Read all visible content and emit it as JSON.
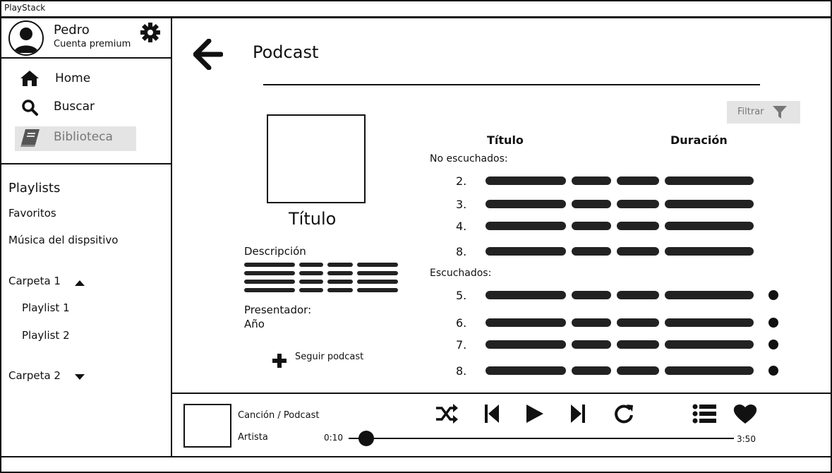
{
  "app": {
    "title": "PlayStack"
  },
  "user": {
    "name": "Pedro",
    "plan": "Cuenta premium"
  },
  "nav": {
    "home": "Home",
    "search": "Buscar",
    "library": "Biblioteca"
  },
  "sidebar": {
    "playlists_title": "Playlists",
    "items": [
      "Favoritos",
      "Música del dispsitivo"
    ],
    "folders": [
      {
        "label": "Carpeta 1",
        "expanded": true,
        "playlists": [
          "Playlist 1",
          "Playlist 2"
        ]
      },
      {
        "label": "Carpeta 2",
        "expanded": false,
        "playlists": []
      }
    ]
  },
  "page": {
    "title": "Podcast",
    "filter_label": "Filtrar"
  },
  "podcast": {
    "title": "Título",
    "description_label": "Descripción",
    "presenter_label": "Presentador:",
    "year_label": "Año",
    "follow_label": "Seguir podcast"
  },
  "episodes": {
    "columns": {
      "title": "Título",
      "duration": "Duración"
    },
    "unheard_label": "No escuchados:",
    "heard_label": "Escuchados:",
    "unheard": [
      {
        "num": "2."
      },
      {
        "num": "3."
      },
      {
        "num": "4."
      },
      {
        "num": "8."
      }
    ],
    "heard": [
      {
        "num": "5."
      },
      {
        "num": "6."
      },
      {
        "num": "7."
      },
      {
        "num": "8."
      }
    ]
  },
  "player": {
    "track": "Canción / Podcast",
    "artist": "Artista",
    "time_current": "0:10",
    "time_total": "3:50",
    "progress": 0.045
  },
  "colors": {
    "accent": "#111111",
    "muted_bg": "#e4e4e4",
    "muted_text": "#777777"
  }
}
